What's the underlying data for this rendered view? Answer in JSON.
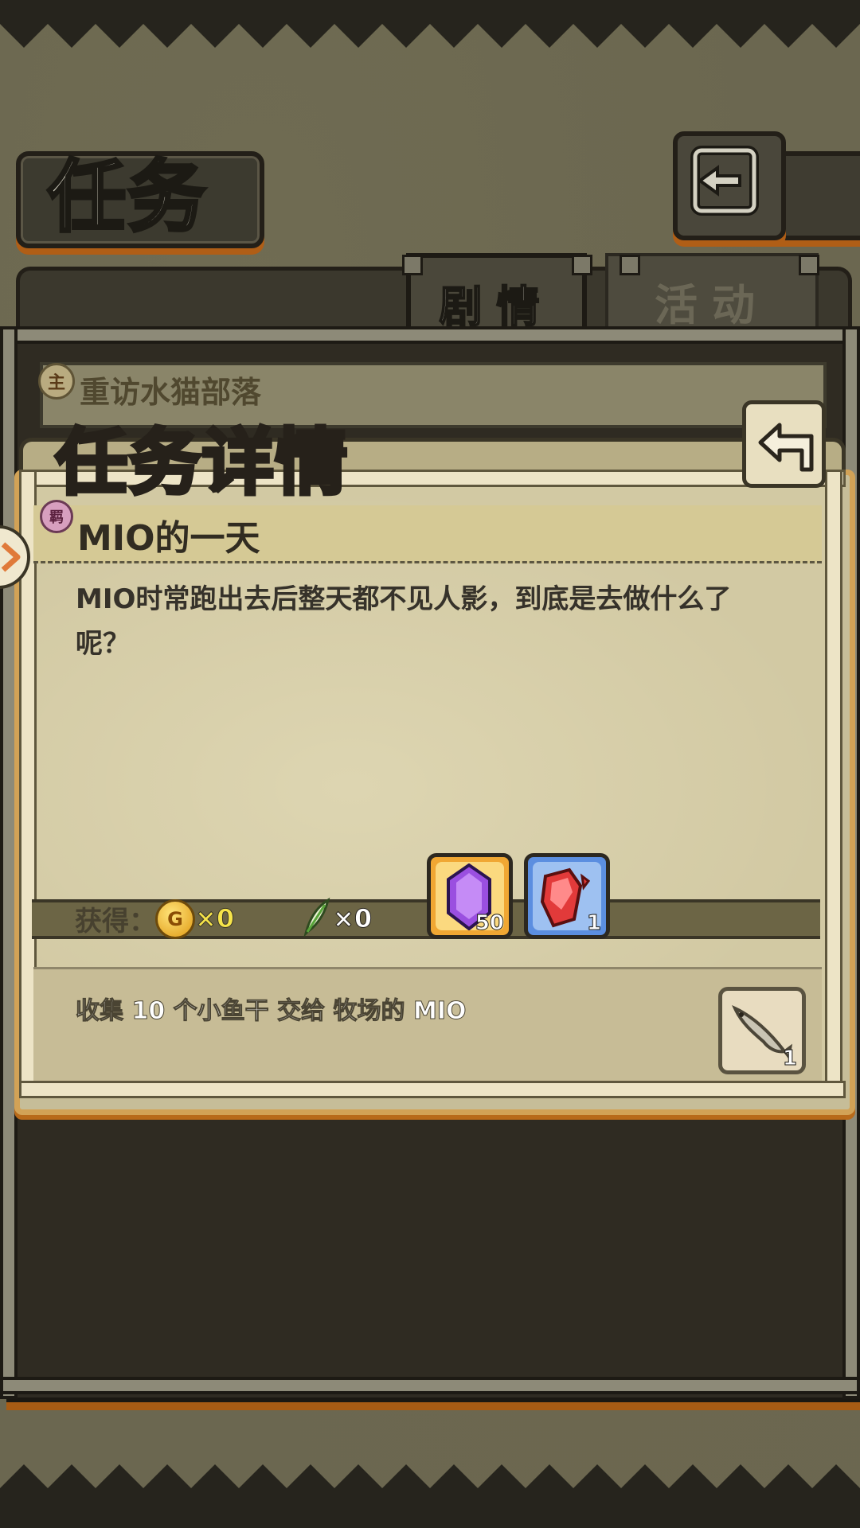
{
  "header": {
    "title": "任务",
    "back_icon": "return-arrow-icon"
  },
  "tabs": [
    {
      "label": "剧情",
      "active": true
    },
    {
      "label": "活动",
      "active": false
    }
  ],
  "quest_list": {
    "item_badge": "主",
    "item_title": "重访水猫部落"
  },
  "detail": {
    "title": "任务详情",
    "back_icon": "return-arrow-icon",
    "quest_badge": "羁",
    "quest_name": "MIO的一天",
    "description": "MIO时常跑出去后整天都不见人影，到底是去做什么了呢？",
    "reward_label": "获得：",
    "gold_symbol": "G",
    "gold_amount": "×0",
    "feather_amount": "×0",
    "reward_items": [
      {
        "icon": "purple-crystal-icon",
        "count": "50"
      },
      {
        "icon": "red-ruby-shard-icon",
        "count": "1"
      }
    ],
    "task_text": "收集 10 个小鱼干 交给 牧场的 MIO",
    "task_item": {
      "icon": "dried-fish-icon",
      "count": "1"
    }
  },
  "colors": {
    "accent_orange": "#d2a256",
    "gold_text": "#f6e44a",
    "panel_parchment": "#d2c9a3"
  }
}
